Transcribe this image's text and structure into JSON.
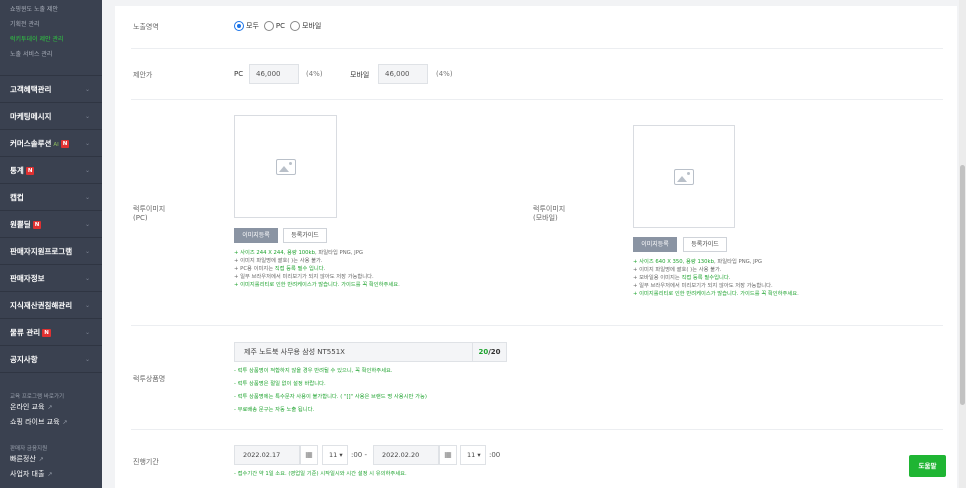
{
  "sidebar": {
    "sub_items": [
      "쇼핑윈도 노출 제안",
      "기획전 관리",
      "럭키투데이 제안 관리",
      "노출 서비스 관리"
    ],
    "menus": [
      {
        "label": "고객혜택관리",
        "badge": ""
      },
      {
        "label": "마케팅메시지",
        "badge": ""
      },
      {
        "label": "커머스솔루션",
        "ai": "AI",
        "badge": "N"
      },
      {
        "label": "통계",
        "badge": "N"
      },
      {
        "label": "캡컵",
        "badge": ""
      },
      {
        "label": "원쁠딜",
        "badge": "N"
      },
      {
        "label": "판매자지원프로그램",
        "badge": ""
      },
      {
        "label": "판매자정보",
        "badge": ""
      },
      {
        "label": "지식재산권침해관리",
        "badge": ""
      },
      {
        "label": "물류 관리",
        "badge": "N"
      },
      {
        "label": "공지사항",
        "badge": ""
      }
    ],
    "section1_title": "교육 프로그램 바로가기",
    "section1_links": [
      "온라인 교육",
      "쇼핑 라이브 교육"
    ],
    "section2_title": "판매자 금융지원",
    "section2_links": [
      "빠른정산",
      "사업자 대출"
    ]
  },
  "form": {
    "exposure": {
      "label": "노출영역",
      "options": [
        "모두",
        "PC",
        "모바일"
      ],
      "selected": "모두"
    },
    "price": {
      "label": "제안가",
      "pc_label": "PC",
      "pc_value": "46,000",
      "pc_pct": "(4%)",
      "mobile_label": "모바일",
      "mobile_value": "46,000",
      "mobile_pct": "(4%)"
    },
    "pc_image": {
      "label": "럭투이미지",
      "sub": "(PC)",
      "register_btn": "이미지등록",
      "guide_btn": "등록가이드",
      "notes": [
        {
          "g": "+ 사이즈 244 X 244, 용량 100kb",
          "d": ", 파일타입 PNG, JPG"
        },
        {
          "g": "",
          "d": "+ 이미지 파일명에 괄호( )는 사용 불가."
        },
        {
          "g": "",
          "d": "+ PC용 이미지는 ",
          "g2": "직접 등록 필수 입니다",
          "d2": "."
        },
        {
          "g": "",
          "d": "+ 일부 브라우저에서 미리보기가 되지 않아도 저장 가능합니다."
        },
        {
          "g": "+ 이미지롤리티로 인한 반려케이스가 많습니다. ",
          "d": "",
          "g2": "가이드를 꼭 확인하주세요",
          "d2": "."
        }
      ]
    },
    "mobile_image": {
      "label": "럭투이미지",
      "sub": "(모바일)",
      "register_btn": "이미지등록",
      "guide_btn": "등록가이드",
      "notes": [
        {
          "g": "+ 사이즈 640 X 350, 용량 130kb",
          "d": ", 파일타입 PNG, JPG"
        },
        {
          "g": "",
          "d": "+ 이미지 파일명에 괄호( )는 사용 불가."
        },
        {
          "g": "",
          "d": "+ 모바일용 이미지는 ",
          "g2": "직접 등록 필수입니다",
          "d2": "."
        },
        {
          "g": "",
          "d": "+ 일부 브라우저에서 미리보기가 되지 않아도 저장 가능합니다."
        },
        {
          "g": "+ 이미지롤리티로 인한 반려케이스가 많습니다. ",
          "d": "",
          "g2": "가이드를 꼭 확인하주세요",
          "d2": "."
        }
      ]
    },
    "product_name": {
      "label": "럭투상품명",
      "value": "제주 노트북 사무용 삼성 NT551X",
      "count": "20",
      "max": "/20",
      "notes": [
        "- 럭투 상품명이 적합하지 않을 경우 반려될 수 있으니, 꼭 확인하주세요.",
        "- 럭투 상품명은 절일 없이 설정 바랍니다.",
        "- 럭투 상품명에는 특수문자 사용이 불가합니다. ( \"[]\" 사용은 브랜드 명 사용시만 가능)",
        "- 무료배송 문구는 자동 노출 됩니다."
      ]
    },
    "period": {
      "label": "진행기간",
      "start_date": "2022.02.17",
      "start_hour": "11",
      "end_date": "2022.02.20",
      "end_hour": "11",
      "minute_suffix": ":00",
      "dash": " -",
      "note": "- 접수기간 약 1일 소요. (영업일 기준) 시작일시와 시간 설정 시 유의하주세요."
    }
  },
  "help_button": "도움말",
  "icons": {
    "calendar": "calendar-icon",
    "chevron": "chevron-down-icon",
    "image": "image-placeholder-icon",
    "external": "external-link-icon"
  }
}
